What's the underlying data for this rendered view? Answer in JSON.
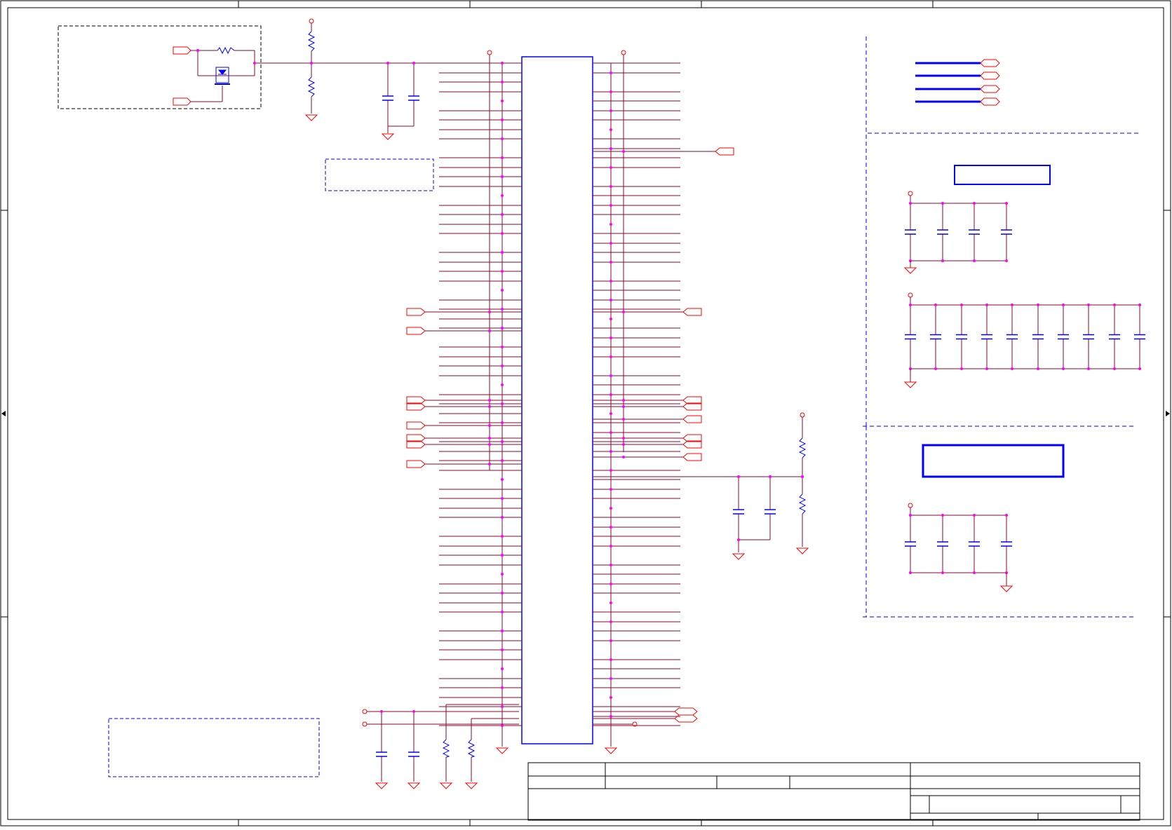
{
  "sheet": {
    "type": "schematic",
    "colors": {
      "border": "#000000",
      "wire": "#8b0a2e",
      "net_flag": "#ff0000",
      "component": "#0000ff",
      "junction": "#ff00ff",
      "note_box": "#0000ff",
      "power_symbol": "#ff0000"
    },
    "ic": {
      "name": "main-ic",
      "left_pin_count": 71,
      "right_pin_count": 71
    },
    "right_panels": [
      "output-nets-panel",
      "decoupling-panel-1",
      "decoupling-panel-2"
    ],
    "title_block": {
      "rows": 3,
      "columns": 4
    },
    "visible_text": []
  }
}
